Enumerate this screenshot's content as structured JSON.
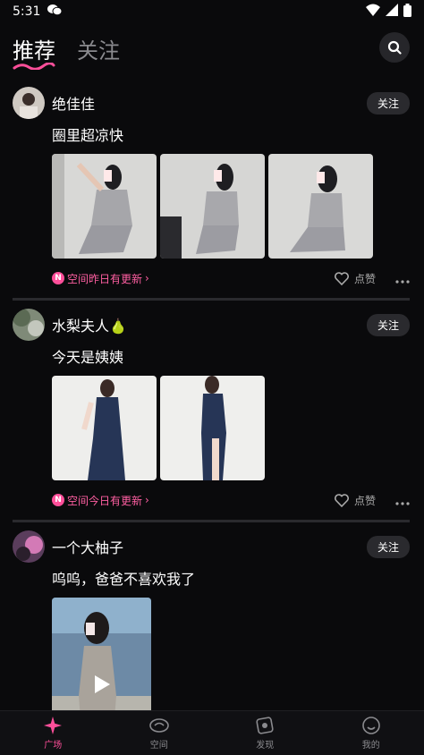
{
  "status": {
    "time": "5:31"
  },
  "header": {
    "tab_recommend": "推荐",
    "tab_follow": "关注"
  },
  "posts": [
    {
      "username": "绝佳佳",
      "text": "圈里超凉快",
      "follow_label": "关注",
      "space_update": "空间昨日有更新",
      "like_label": "点赞",
      "image_count": 3
    },
    {
      "username": "水梨夫人🍐",
      "text": "今天是姨姨",
      "follow_label": "关注",
      "space_update": "空间今日有更新",
      "like_label": "点赞",
      "image_count": 2
    },
    {
      "username": "一个大柚子",
      "text": "呜呜，爸爸不喜欢我了",
      "follow_label": "关注",
      "media": "video"
    }
  ],
  "badge": {
    "letter": "N",
    "chevron": "›"
  },
  "nav": [
    {
      "label": "广场",
      "icon": "plaza-icon",
      "active": true
    },
    {
      "label": "空间",
      "icon": "space-icon",
      "active": false
    },
    {
      "label": "发现",
      "icon": "discover-icon",
      "active": false
    },
    {
      "label": "我的",
      "icon": "profile-icon",
      "active": false
    }
  ],
  "colors": {
    "accent": "#ff4f9a",
    "background": "#0a0a0c",
    "button_bg": "#2a2a2e"
  }
}
